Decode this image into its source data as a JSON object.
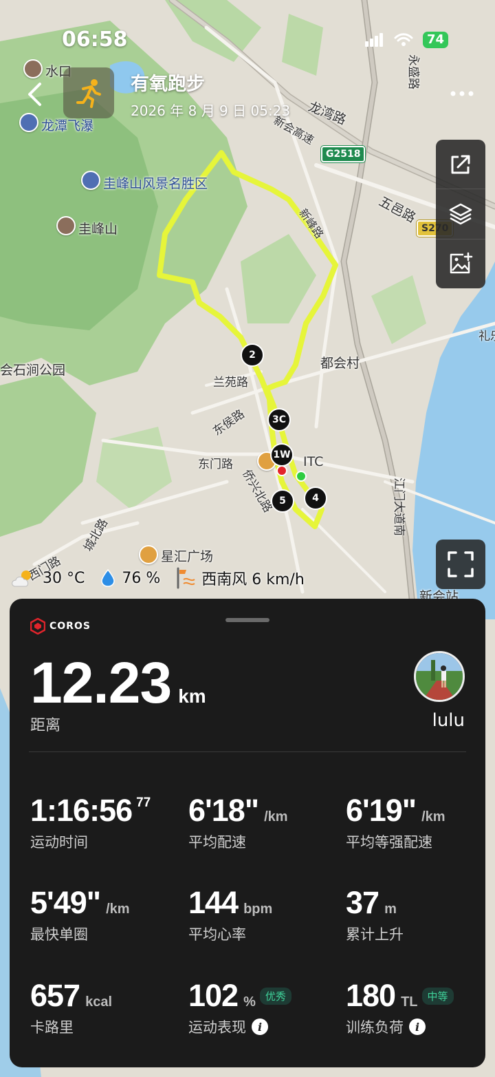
{
  "status_bar": {
    "time": "06:58",
    "battery": "74"
  },
  "header": {
    "title": "有氧跑步",
    "datetime": "2026 年 8 月 9 日 05:23"
  },
  "map": {
    "labels": {
      "shuikou": "水口",
      "longtan": "龙潭飞瀑",
      "guifeng_scenic": "圭峰山风景名胜区",
      "guifeng": "圭峰山",
      "longwan_rd": "龙湾路",
      "xinhui_expwy": "新会高速",
      "yongsheng_rd": "永盛路",
      "wuyi_rd": "五邑路",
      "xinfeng_rd": "新峰路",
      "duhui_village": "都会村",
      "lanyuan_rd": "兰苑路",
      "donghou_rd": "东侯路",
      "dongmen_rd": "东门路",
      "qiaoxing_n_rd": "侨兴北路",
      "itc": "ITC",
      "jiangmen_ave": "江门大道南",
      "xingfeng_plaza": "星汇广场",
      "ximen_rd": "西门路",
      "chengbei_rd": "城北路",
      "shijian_park": "会石涧公园",
      "xinhui_station": "新会站",
      "lixi": "礼乐"
    },
    "shields": {
      "g2518": "G2518",
      "s270": "S270"
    },
    "markers": {
      "m2": "2",
      "m3c": "3C",
      "m1w": "1W",
      "m4": "4",
      "m5": "5"
    },
    "route_color": "#e6f53a"
  },
  "weather": {
    "temperature": "30 °C",
    "humidity": "76 %",
    "wind": "西南风 6 km/h"
  },
  "panel": {
    "brand": "COROS",
    "distance": {
      "value": "12.23",
      "unit": "km",
      "label": "距离"
    },
    "username": "lulu",
    "stats": {
      "duration": {
        "value": "1:16:56",
        "sup": "77",
        "label": "运动时间"
      },
      "avg_pace": {
        "value": "6'18\"",
        "unit": "/km",
        "label": "平均配速"
      },
      "avg_grade_pace": {
        "value": "6'19\"",
        "unit": "/km",
        "label": "平均等强配速"
      },
      "fastest_lap": {
        "value": "5'49\"",
        "unit": "/km",
        "label": "最快单圈"
      },
      "avg_hr": {
        "value": "144",
        "unit": "bpm",
        "label": "平均心率"
      },
      "elevation_gain": {
        "value": "37",
        "unit": "m",
        "label": "累计上升"
      },
      "calories": {
        "value": "657",
        "unit": "kcal",
        "label": "卡路里"
      },
      "performance": {
        "value": "102",
        "unit": "%",
        "badge": "优秀",
        "label": "运动表现"
      },
      "training_load": {
        "value": "180",
        "unit": "TL",
        "badge": "中等",
        "label": "训练负荷"
      }
    },
    "accent_color": "#3fd29a"
  }
}
